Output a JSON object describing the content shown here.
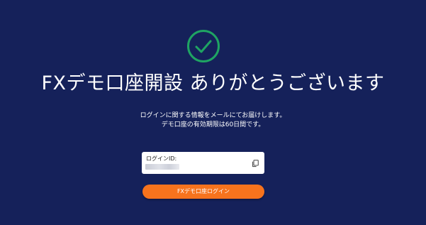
{
  "title": "FXデモ口座開設 ありがとうございます",
  "messages": {
    "line1": "ログインに関する情報をメールにてお届けします。",
    "line2": "デモ口座の有効期限は60日間です。"
  },
  "login_card": {
    "label": "ログインID:",
    "value": "",
    "copy_icon": "copy-icon"
  },
  "button": {
    "label": "FXデモ口座ログイン"
  },
  "colors": {
    "background": "#15215a",
    "success_green": "#1fa463",
    "button_orange": "#f7731d",
    "card_white": "#ffffff"
  },
  "icons": {
    "success": "check-circle-icon",
    "copy": "copy-icon"
  }
}
